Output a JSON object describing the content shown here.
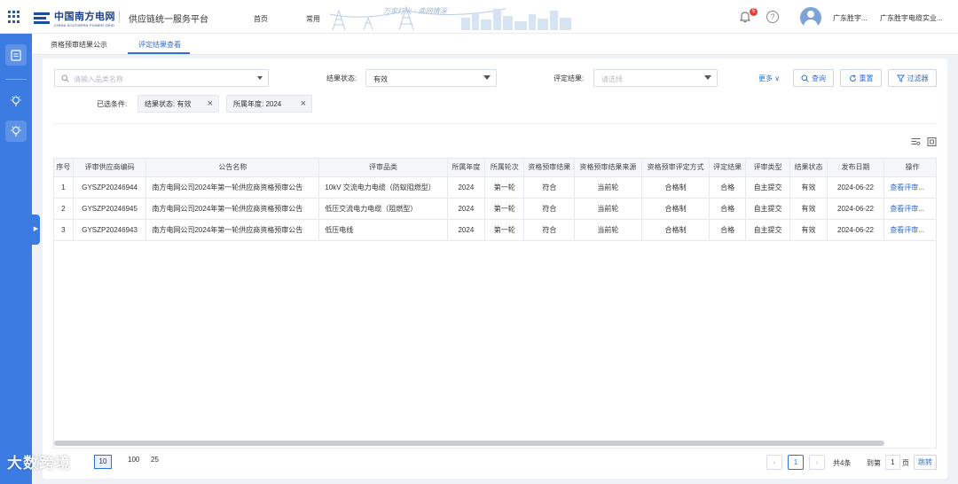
{
  "header": {
    "brand_cn": "中国南方电网",
    "brand_en": "CHINA SOUTHERN POWER GRID",
    "platform": "供应链统一服务平台",
    "nav": [
      "首页",
      "常用"
    ],
    "banner_slogan": "万家灯火 · 南网情深",
    "notification_count": "5",
    "user_short": "广东胜宇...",
    "org_short": "广东胜宇电缆实业..."
  },
  "tabs": [
    {
      "label": "资格预审结果公示",
      "active": false
    },
    {
      "label": "评定结果查看",
      "active": true
    }
  ],
  "filters": {
    "product_placeholder": "请输入品类名称",
    "result_status_label": "结果状态:",
    "result_status_value": "有效",
    "eval_result_label": "评定结果:",
    "eval_result_placeholder": "请选择",
    "more_label": "更多",
    "query_label": "查询",
    "reset_label": "重置",
    "filter_label": "过滤器"
  },
  "selected": {
    "label": "已选条件:",
    "chips": [
      "结果状态: 有效",
      "所属年度: 2024"
    ]
  },
  "table": {
    "columns": [
      "序号",
      "评审供应商编码",
      "公告名称",
      "评审品类",
      "所属年度",
      "所属轮次",
      "资格预审结果",
      "资格预审结果来源",
      "资格预审评定方式",
      "评定结果",
      "评审类型",
      "结果状态",
      "发布日期",
      "操作"
    ],
    "rows": [
      [
        "1",
        "GYSZP20246944",
        "南方电网公司2024年第一轮供应商资格预审公告",
        "10kV 交流电力电缆（防蚁阻燃型）",
        "2024",
        "第一轮",
        "符合",
        "当前轮",
        "合格制",
        "合格",
        "自主提交",
        "有效",
        "2024-06-22",
        "查看评审..."
      ],
      [
        "2",
        "GYSZP20246945",
        "南方电网公司2024年第一轮供应商资格预审公告",
        "低压交流电力电缆（阻燃型）",
        "2024",
        "第一轮",
        "符合",
        "当前轮",
        "合格制",
        "合格",
        "自主提交",
        "有效",
        "2024-06-22",
        "查看评审..."
      ],
      [
        "3",
        "GYSZP20246943",
        "南方电网公司2024年第一轮供应商资格预审公告",
        "低压电线",
        "2024",
        "第一轮",
        "符合",
        "当前轮",
        "合格制",
        "合格",
        "自主提交",
        "有效",
        "2024-06-22",
        "查看评审..."
      ]
    ]
  },
  "pagination": {
    "page_sizes": [
      "10",
      "100",
      "25"
    ],
    "current_page": "1",
    "total_text": "共4条",
    "goto_prefix": "到第",
    "goto_value": "1",
    "goto_suffix": "页",
    "goto_button": "跳转"
  },
  "watermark": "大数跨境",
  "colors": {
    "primary": "#2f6fd6",
    "rail": "#3b7be2",
    "brand": "#1a3f8c"
  }
}
